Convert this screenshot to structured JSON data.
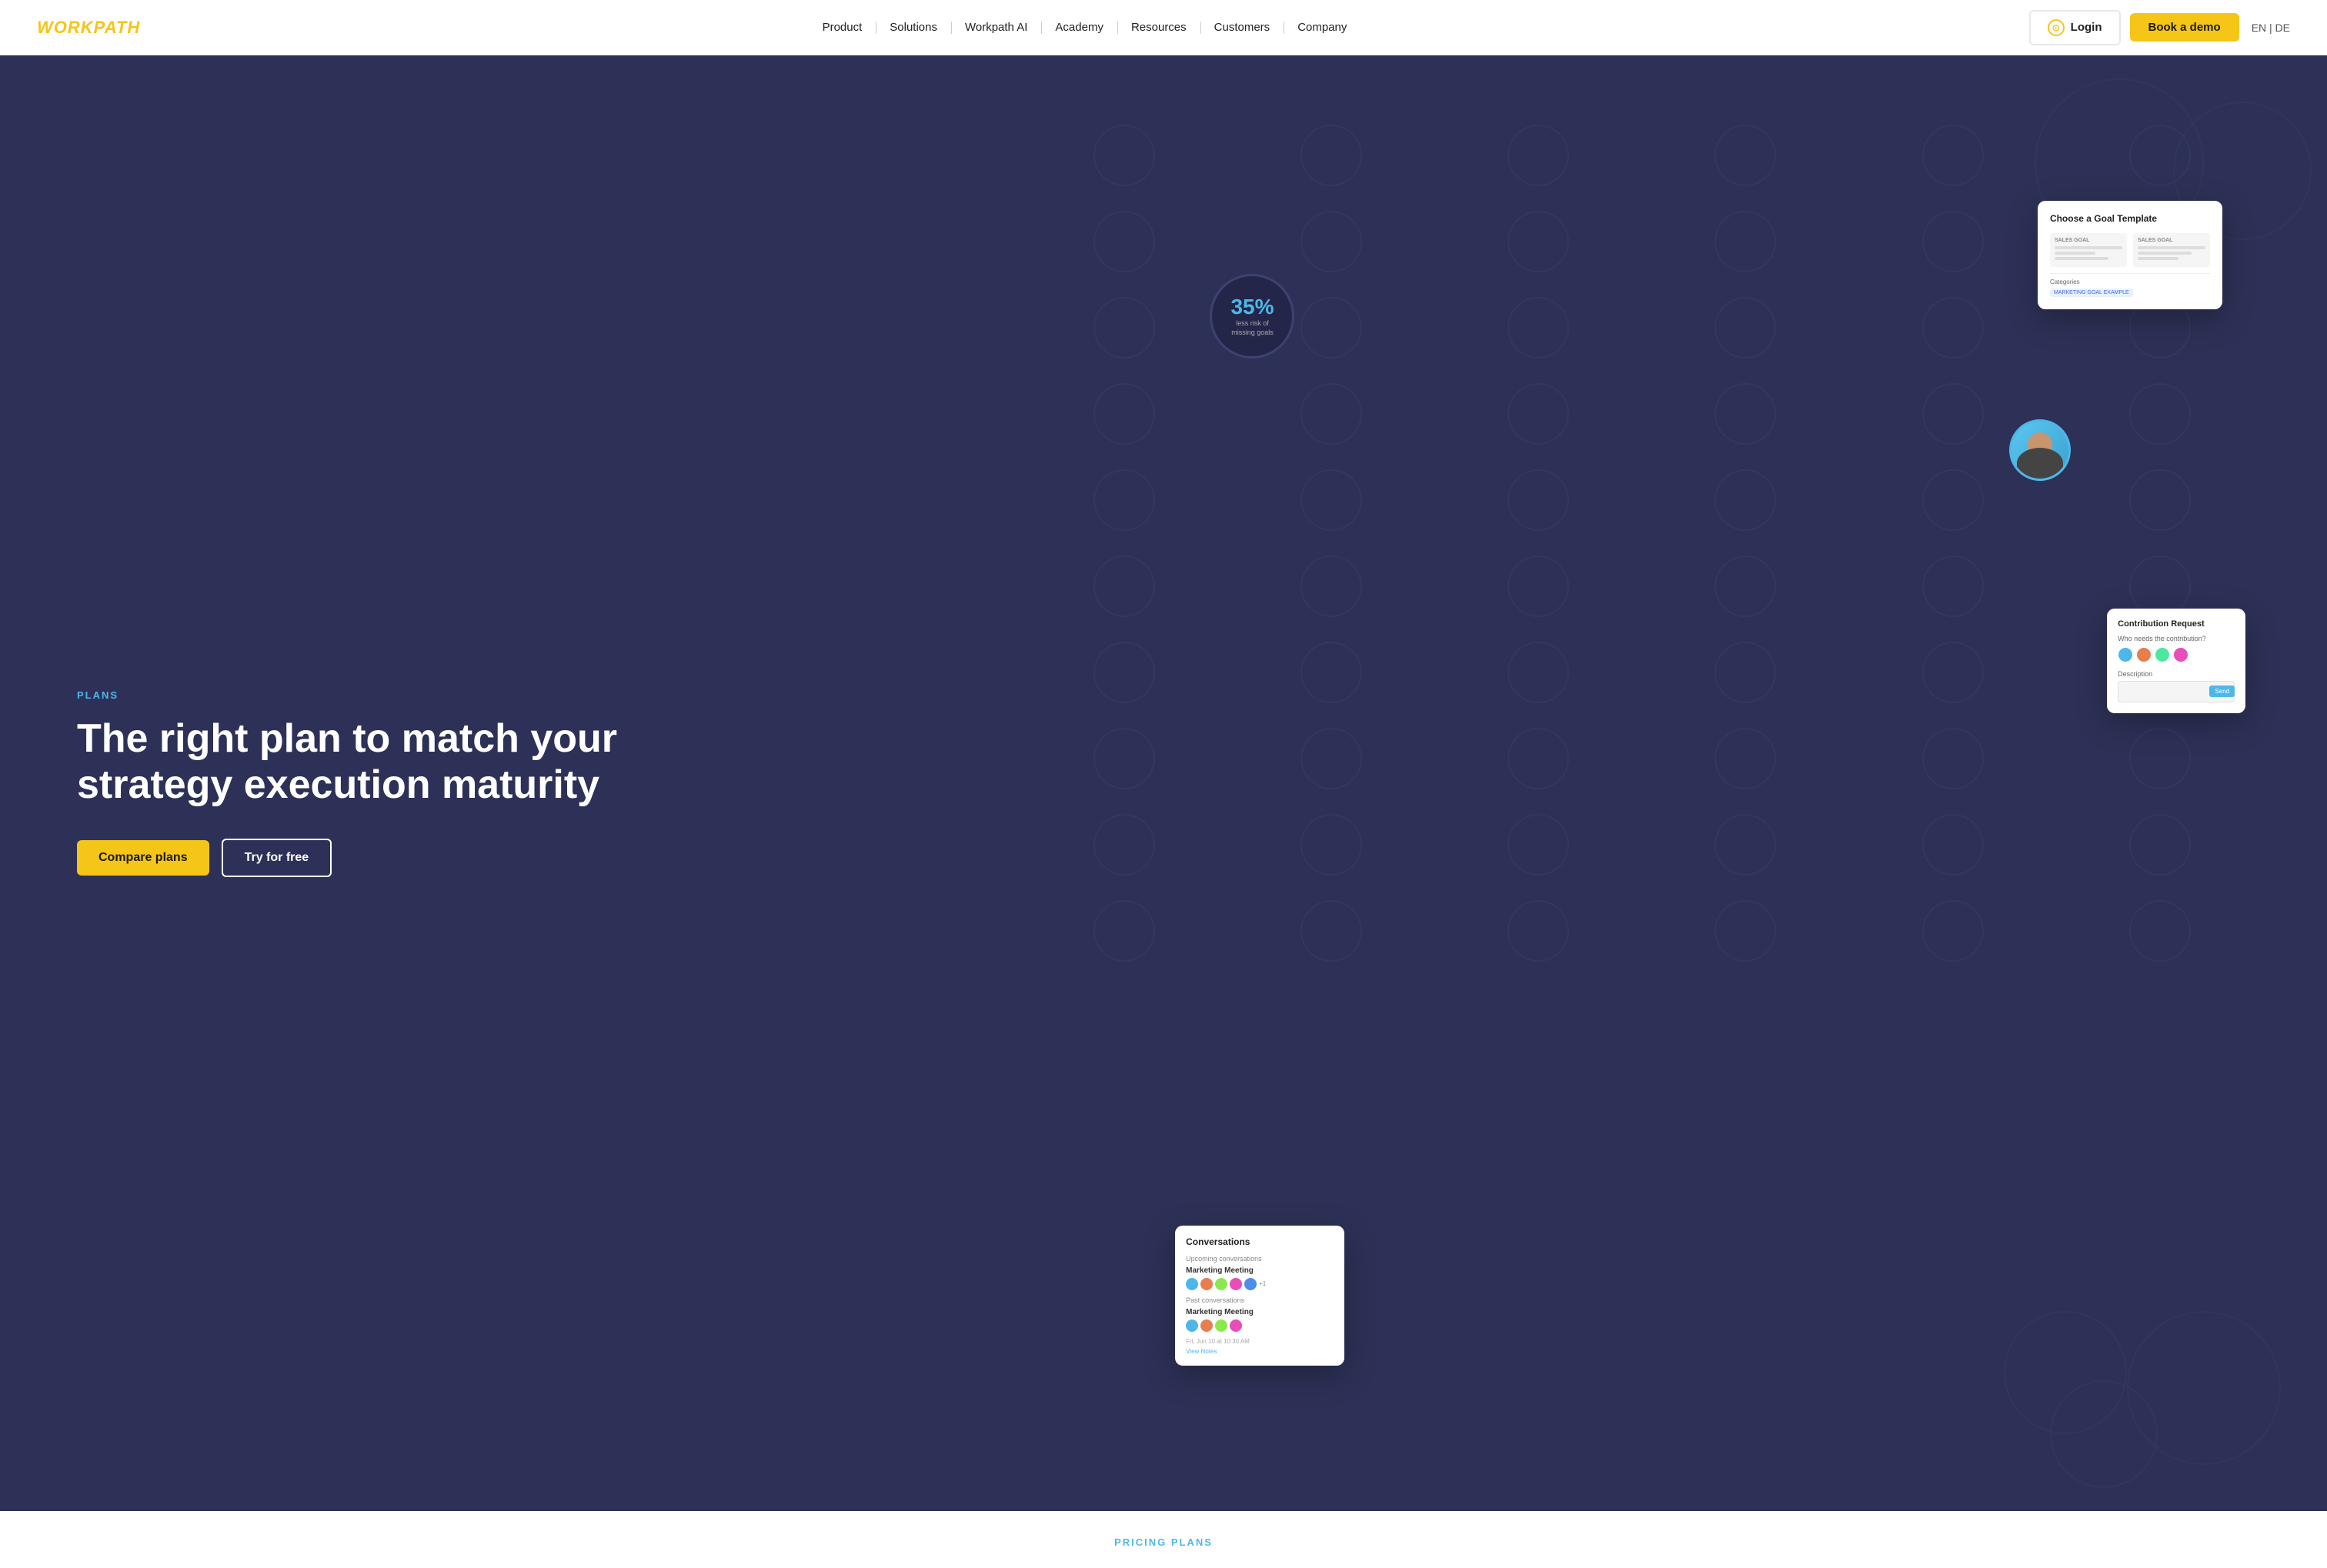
{
  "nav": {
    "logo": "WORKPATH",
    "links": [
      {
        "label": "Product",
        "id": "product"
      },
      {
        "label": "Solutions",
        "id": "solutions"
      },
      {
        "label": "Workpath AI",
        "id": "workpath-ai"
      },
      {
        "label": "Academy",
        "id": "academy"
      },
      {
        "label": "Resources",
        "id": "resources"
      },
      {
        "label": "Customers",
        "id": "customers"
      },
      {
        "label": "Company",
        "id": "company"
      }
    ],
    "login_label": "Login",
    "demo_label": "Book a demo",
    "lang": "EN | DE"
  },
  "hero": {
    "eyebrow": "PLANS",
    "title_line1": "The right plan to match your",
    "title_line2": "strategy execution maturity",
    "btn_compare": "Compare plans",
    "btn_try": "Try for free"
  },
  "stat": {
    "number": "35%",
    "label_line1": "less risk of",
    "label_line2": "missing goals"
  },
  "card_goal": {
    "title": "Choose a Goal Template",
    "col1_label": "SALES GOAL",
    "col2_label": "SALES GOAL",
    "categories_label": "Categories",
    "tag": "MARKETING GOAL EXAMPLE"
  },
  "card_contribution": {
    "title": "Contribution Request",
    "who_label": "Who needs the contribution?",
    "desc_label": "Description",
    "send_label": "Send"
  },
  "card_conversations": {
    "title": "Conversations",
    "upcoming_label": "Upcoming conversations",
    "upcoming_item": "Marketing Meeting",
    "past_label": "Past conversations",
    "past_item": "Marketing Meeting",
    "time": "Fri, Jun 10 at 10:30 AM",
    "view_notes": "View Notes"
  },
  "pricing": {
    "label": "PRICING PLANS"
  }
}
